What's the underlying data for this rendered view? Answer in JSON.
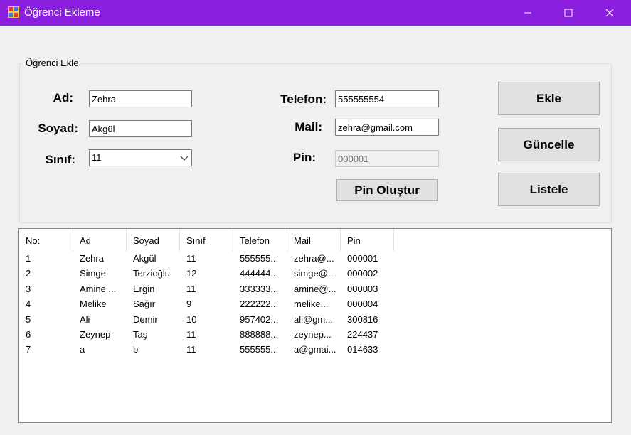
{
  "window": {
    "title": "Öğrenci Ekleme"
  },
  "group": {
    "title": "Öğrenci Ekle"
  },
  "form": {
    "ad_label": "Ad:",
    "ad_value": "Zehra",
    "soyad_label": "Soyad:",
    "soyad_value": "Akgül",
    "sinif_label": "Sınıf:",
    "sinif_value": "11",
    "telefon_label": "Telefon:",
    "telefon_value": "555555554",
    "mail_label": "Mail:",
    "mail_value": "zehra@gmail.com",
    "pin_label": "Pin:",
    "pin_value": "000001",
    "pin_button": "Pin Oluştur"
  },
  "actions": {
    "ekle": "Ekle",
    "guncelle": "Güncelle",
    "listele": "Listele"
  },
  "table": {
    "columns": [
      "No:",
      "Ad",
      "Soyad",
      "Sınıf",
      "Telefon",
      "Mail",
      "Pin"
    ],
    "rows": [
      [
        "1",
        "Zehra",
        "Akgül",
        "11",
        "555555...",
        "zehra@...",
        "000001"
      ],
      [
        "2",
        "Simge",
        "Terzioğlu",
        "12",
        "444444...",
        "simge@...",
        "000002"
      ],
      [
        "3",
        "Amine ...",
        "Ergin",
        "11",
        "333333...",
        "amine@...",
        "000003"
      ],
      [
        "4",
        "Melike",
        "Sağır",
        "9",
        "222222...",
        "melike...",
        "000004"
      ],
      [
        "5",
        "Ali",
        "Demir",
        "10",
        "957402...",
        "ali@gm...",
        "300816"
      ],
      [
        "6",
        "Zeynep",
        "Taş",
        "11",
        "888888...",
        "zeynep...",
        "224437"
      ],
      [
        "7",
        "a",
        "b",
        "11",
        "555555...",
        "a@gmai...",
        "014633"
      ]
    ]
  }
}
